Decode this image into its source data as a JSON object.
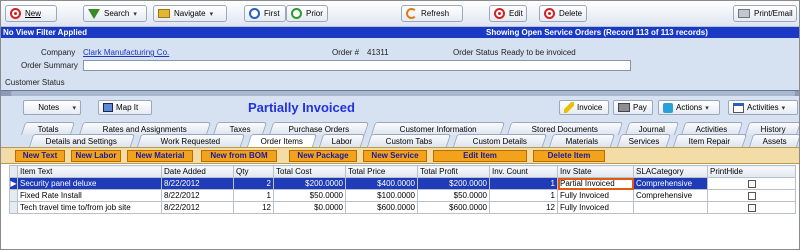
{
  "toolbar": {
    "new": "New",
    "search": "Search",
    "navigate": "Navigate",
    "first": "First",
    "prior": "Prior",
    "refresh": "Refresh",
    "edit": "Edit",
    "delete": "Delete",
    "print_email": "Print/Email"
  },
  "status": {
    "filter": "No View Filter Applied",
    "showing": "Showing Open Service Orders   (Record 113 of 113 records)"
  },
  "header": {
    "company_label": "Company",
    "company_value": "Clark Manufacturing Co.",
    "order_label": "Order #",
    "order_value": "41311",
    "order_status_label": "Order Status",
    "order_status_value": "Ready to be invoiced",
    "summary_label": "Order Summary",
    "customer_status_label": "Customer Status"
  },
  "actions": {
    "notes": "Notes",
    "map_it": "Map It",
    "title": "Partially Invoiced",
    "invoice": "Invoice",
    "pay": "Pay",
    "actions": "Actions",
    "activities": "Activities"
  },
  "tabs": {
    "row1": [
      "Totals",
      "Rates and Assignments",
      "Taxes",
      "Purchase Orders",
      "Customer Information",
      "Stored Documents",
      "Journal",
      "Activities",
      "History"
    ],
    "row2": [
      "Details and Settings",
      "Work Requested",
      "Order Items",
      "Labor",
      "Custom Tabs",
      "Custom Details",
      "Materials",
      "Services",
      "Item Repair",
      "Assets"
    ]
  },
  "order_buttons": [
    "New Text",
    "New Labor",
    "New Material",
    "New from BOM",
    "New Package",
    "New Service",
    "Edit Item",
    "Delete Item"
  ],
  "grid": {
    "columns": [
      "Item Text",
      "Date Added",
      "Qty",
      "Total Cost",
      "Total Price",
      "Total Profit",
      "Inv. Count",
      "Inv State",
      "SLACategory",
      "PrintHide"
    ],
    "rows": [
      {
        "item_text": "Security panel deluxe",
        "date_added": "8/22/2012",
        "qty": "2",
        "total_cost": "$200.0000",
        "total_price": "$400.0000",
        "total_profit": "$200.0000",
        "inv_count": "1",
        "inv_state": "Partial Invoiced",
        "sla_category": "Comprehensive",
        "selected": true
      },
      {
        "item_text": "Fixed Rate Install",
        "date_added": "8/22/2012",
        "qty": "1",
        "total_cost": "$50.0000",
        "total_price": "$100.0000",
        "total_profit": "$50.0000",
        "inv_count": "1",
        "inv_state": "Fully Invoiced",
        "sla_category": "Comprehensive",
        "selected": false
      },
      {
        "item_text": "Tech travel time to/from job site",
        "date_added": "8/22/2012",
        "qty": "12",
        "total_cost": "$0.0000",
        "total_price": "$600.0000",
        "total_profit": "$600.0000",
        "inv_count": "12",
        "inv_state": "Fully Invoiced",
        "sla_category": "",
        "selected": false
      }
    ]
  },
  "icons": {
    "new": "new-circle-icon",
    "search": "funnel-icon",
    "navigate": "navigate-icon",
    "first": "first-record-icon",
    "prior": "prior-record-icon",
    "refresh": "refresh-icon",
    "edit": "edit-icon",
    "delete": "delete-icon",
    "print": "printer-icon"
  },
  "colors": {
    "status_bar": "#1a39c4",
    "panel_bg": "#d6e2f2",
    "order_button": "#f2a31b",
    "selected_row": "#1f3bb8",
    "highlight": "#e05a10",
    "title": "#2233dd"
  }
}
